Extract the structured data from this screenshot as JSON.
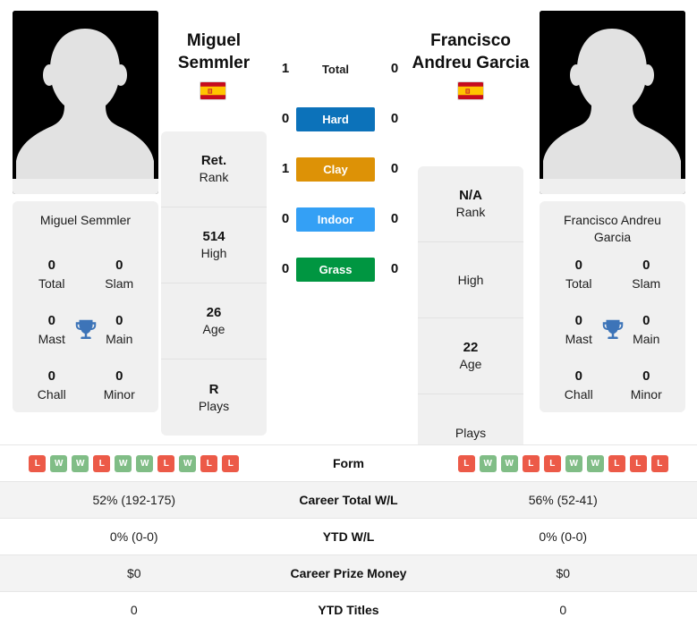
{
  "players": {
    "left": {
      "name_header": "Miguel\nSemmler",
      "name_line1": "Miguel",
      "name_line2": "Semmler",
      "card_name": "Miguel Semmler",
      "flag": "spain-flag",
      "info": [
        {
          "value": "Ret.",
          "label": "Rank"
        },
        {
          "value": "514",
          "label": "High"
        },
        {
          "value": "26",
          "label": "Age"
        },
        {
          "value": "R",
          "label": "Plays"
        }
      ],
      "titles": [
        {
          "value": "0",
          "label": "Total"
        },
        {
          "value": "0",
          "label": "Slam"
        },
        {
          "value": "0",
          "label": "Mast"
        },
        {
          "value": "0",
          "label": "Main"
        },
        {
          "value": "0",
          "label": "Chall"
        },
        {
          "value": "0",
          "label": "Minor"
        }
      ],
      "form": [
        "L",
        "W",
        "W",
        "L",
        "W",
        "W",
        "L",
        "W",
        "L",
        "L"
      ],
      "career_total_wl": "52% (192-175)",
      "ytd_wl": "0% (0-0)",
      "career_prize_money": "$0",
      "ytd_titles": "0"
    },
    "right": {
      "name_header": "Francisco\nAndreu Garcia",
      "name_line1": "Francisco",
      "name_line2": "Andreu Garcia",
      "card_name": "Francisco Andreu Garcia",
      "flag": "spain-flag",
      "info": [
        {
          "value": "N/A",
          "label": "Rank"
        },
        {
          "value": "",
          "label": "High"
        },
        {
          "value": "22",
          "label": "Age"
        },
        {
          "value": "",
          "label": "Plays"
        }
      ],
      "titles": [
        {
          "value": "0",
          "label": "Total"
        },
        {
          "value": "0",
          "label": "Slam"
        },
        {
          "value": "0",
          "label": "Mast"
        },
        {
          "value": "0",
          "label": "Main"
        },
        {
          "value": "0",
          "label": "Chall"
        },
        {
          "value": "0",
          "label": "Minor"
        }
      ],
      "form": [
        "L",
        "W",
        "W",
        "L",
        "L",
        "W",
        "W",
        "L",
        "L",
        "L"
      ],
      "career_total_wl": "56% (52-41)",
      "ytd_wl": "0% (0-0)",
      "career_prize_money": "$0",
      "ytd_titles": "0"
    }
  },
  "head_to_head": {
    "rows": [
      {
        "label": "Total",
        "left": "1",
        "right": "0",
        "color": "",
        "style": "plain"
      },
      {
        "label": "Hard",
        "left": "0",
        "right": "0",
        "color": "#0c72ba",
        "style": "pill"
      },
      {
        "label": "Clay",
        "left": "1",
        "right": "0",
        "color": "#dd9206",
        "style": "pill"
      },
      {
        "label": "Indoor",
        "left": "0",
        "right": "0",
        "color": "#34a0f5",
        "style": "pill"
      },
      {
        "label": "Grass",
        "left": "0",
        "right": "0",
        "color": "#009641",
        "style": "pill"
      }
    ]
  },
  "comparison_table": {
    "rows": [
      {
        "label": "Form",
        "type": "form",
        "left": "",
        "right": "",
        "stripe": "plain"
      },
      {
        "label": "Career Total W/L",
        "type": "text",
        "left": "52% (192-175)",
        "right": "56% (52-41)",
        "stripe": "alt"
      },
      {
        "label": "YTD W/L",
        "type": "text",
        "left": "0% (0-0)",
        "right": "0% (0-0)",
        "stripe": "plain"
      },
      {
        "label": "Career Prize Money",
        "type": "text",
        "left": "$0",
        "right": "$0",
        "stripe": "alt"
      },
      {
        "label": "YTD Titles",
        "type": "text",
        "left": "0",
        "right": "0",
        "stripe": "plain"
      }
    ]
  },
  "colors": {
    "hard": "#0c72ba",
    "clay": "#dd9206",
    "indoor": "#34a0f5",
    "grass": "#009641",
    "win_badge": "#80bd86",
    "loss_badge": "#ec5a48",
    "trophy": "#3d74b8",
    "card_bg": "#f0f0f0"
  }
}
